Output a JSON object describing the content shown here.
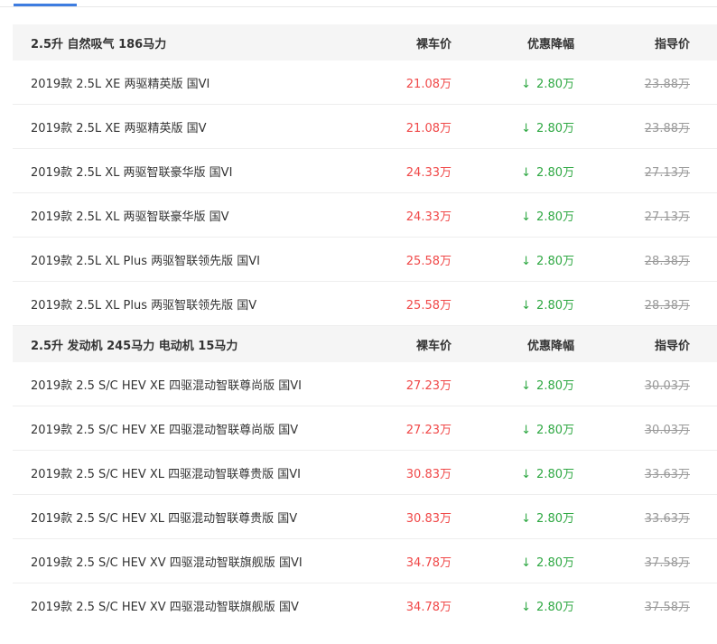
{
  "columns": {
    "price": "裸车价",
    "discount": "优惠降幅",
    "guide": "指导价"
  },
  "colors": {
    "price": "#f04848",
    "discount": "#2fa843",
    "guide": "#999999",
    "tab_accent": "#3d7ce0"
  },
  "groups": [
    {
      "title": "2.5升 自然吸气 186马力",
      "rows": [
        {
          "name": "2019款 2.5L XE 两驱精英版 国VI",
          "price": "21.08万",
          "discount": "2.80万",
          "guide": "23.88万"
        },
        {
          "name": "2019款 2.5L XE 两驱精英版 国V",
          "price": "21.08万",
          "discount": "2.80万",
          "guide": "23.88万"
        },
        {
          "name": "2019款 2.5L XL 两驱智联豪华版 国VI",
          "price": "24.33万",
          "discount": "2.80万",
          "guide": "27.13万"
        },
        {
          "name": "2019款 2.5L XL 两驱智联豪华版 国V",
          "price": "24.33万",
          "discount": "2.80万",
          "guide": "27.13万"
        },
        {
          "name": "2019款 2.5L XL Plus 两驱智联领先版 国VI",
          "price": "25.58万",
          "discount": "2.80万",
          "guide": "28.38万"
        },
        {
          "name": "2019款 2.5L XL Plus 两驱智联领先版 国V",
          "price": "25.58万",
          "discount": "2.80万",
          "guide": "28.38万"
        }
      ]
    },
    {
      "title": "2.5升 发动机 245马力 电动机 15马力",
      "rows": [
        {
          "name": "2019款 2.5 S/C HEV XE 四驱混动智联尊尚版 国VI",
          "price": "27.23万",
          "discount": "2.80万",
          "guide": "30.03万"
        },
        {
          "name": "2019款 2.5 S/C HEV XE 四驱混动智联尊尚版 国V",
          "price": "27.23万",
          "discount": "2.80万",
          "guide": "30.03万"
        },
        {
          "name": "2019款 2.5 S/C HEV XL 四驱混动智联尊贵版 国VI",
          "price": "30.83万",
          "discount": "2.80万",
          "guide": "33.63万"
        },
        {
          "name": "2019款 2.5 S/C HEV XL 四驱混动智联尊贵版 国V",
          "price": "30.83万",
          "discount": "2.80万",
          "guide": "33.63万"
        },
        {
          "name": "2019款 2.5 S/C HEV XV 四驱混动智联旗舰版 国VI",
          "price": "34.78万",
          "discount": "2.80万",
          "guide": "37.58万"
        },
        {
          "name": "2019款 2.5 S/C HEV XV 四驱混动智联旗舰版 国V",
          "price": "34.78万",
          "discount": "2.80万",
          "guide": "37.58万"
        }
      ]
    }
  ]
}
